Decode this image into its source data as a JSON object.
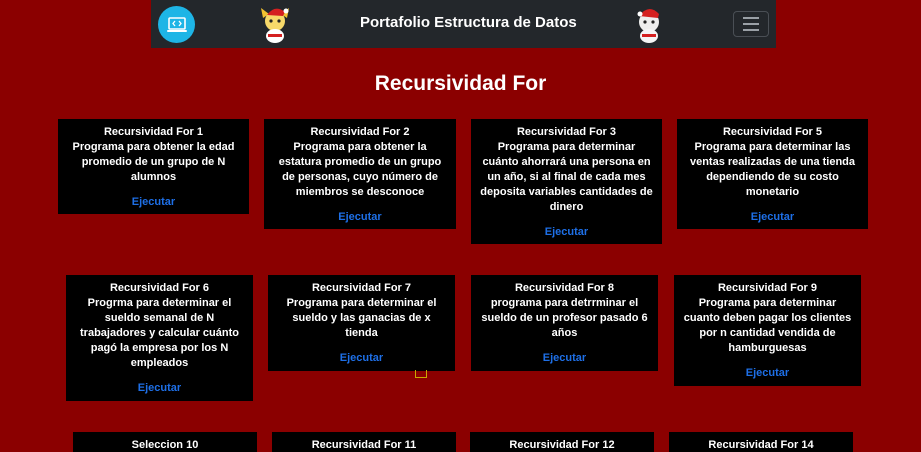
{
  "nav": {
    "title": "Portafolio Estructura de Datos",
    "icons": {
      "brand": "code-laptop-icon",
      "mascot": "christmas-mascot-icon",
      "menu": "hamburger-menu-icon"
    },
    "colors": {
      "navbar": "#23272b",
      "brand": "#1eb5e6"
    }
  },
  "page": {
    "title": "Recursividad For",
    "background": "#8b0000",
    "link_color": "#1e6fe6"
  },
  "cards": [
    {
      "title": "Recursividad For 1",
      "description": "Programa para obtener la edad promedio de un grupo de N alumnos",
      "button": "Ejecutar"
    },
    {
      "title": "Recursividad For 2",
      "description": "Programa para obtener la estatura promedio de un grupo de personas, cuyo número de miembros se desconoce",
      "button": "Ejecutar"
    },
    {
      "title": "Recursividad For 3",
      "description": "Programa para determinar cuánto ahorrará una persona en un año, si al final de cada mes deposita variables cantidades de dinero",
      "button": "Ejecutar"
    },
    {
      "title": "Recursividad For 5",
      "description": "Programa para determinar las ventas realizadas de una tienda dependiendo de su costo monetario",
      "button": "Ejecutar"
    },
    {
      "title": "Recursividad For 6",
      "description": "Progrma para determinar el sueldo semanal de N trabajadores y calcular cuánto pagó la empresa por los N empleados",
      "button": "Ejecutar"
    },
    {
      "title": "Recursividad For 7",
      "description": "Programa para determinar el sueldo y las ganacias de x tienda",
      "button": "Ejecutar"
    },
    {
      "title": "Recursividad For 8",
      "description": "programa para detrrminar el sueldo de un profesor pasado 6 años",
      "button": "Ejecutar"
    },
    {
      "title": "Recursividad For 9",
      "description": "Programa para determinar cuanto deben pagar los clientes por n cantidad vendida de hamburguesas",
      "button": "Ejecutar"
    },
    {
      "title": "Seleccion 10"
    },
    {
      "title": "Recursividad For 11"
    },
    {
      "title": "Recursividad For 12"
    },
    {
      "title": "Recursividad For 14"
    }
  ]
}
